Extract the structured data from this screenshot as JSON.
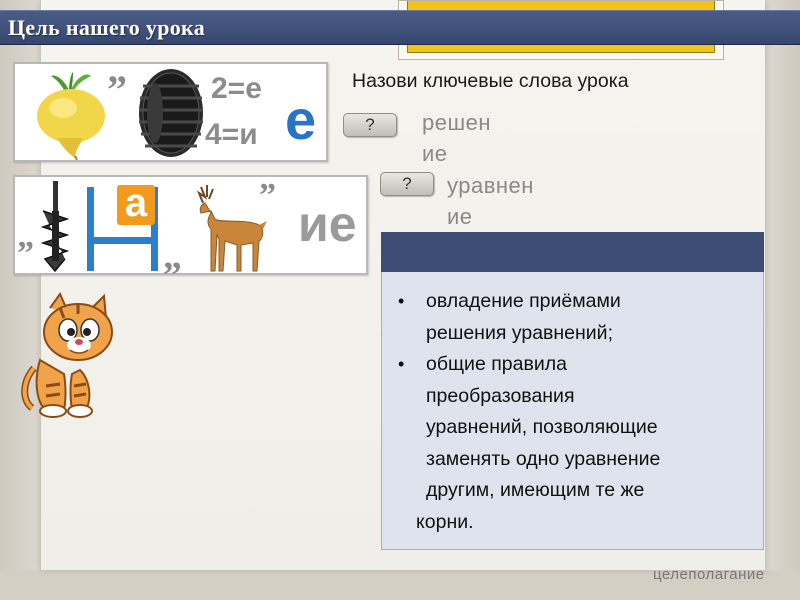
{
  "title": "Цель нашего урока",
  "task": "Назови ключевые слова урока",
  "answer_buttons": {
    "first": "?",
    "second": "?"
  },
  "answers": {
    "first_line1": "решен",
    "first_line2": "ие",
    "second_line1": "уравнен",
    "second_line2": "ие"
  },
  "rebus_1": {
    "quote_after_turnip": "”",
    "eq_top": "2=е",
    "eq_bottom": "4=и",
    "letter": "е"
  },
  "rebus_2": {
    "quote_left": "”",
    "quote_mid": "„",
    "quote_top": "”",
    "letter_a": "а",
    "suffix": "ие"
  },
  "goals": {
    "header": "",
    "items": [
      {
        "lines": [
          "овладение приёмами",
          "решения уравнений;"
        ]
      },
      {
        "lines": [
          "общие правила",
          "преобразования",
          "уравнений, позволяющие",
          "заменять одно уравнение",
          "другим, имеющим те же"
        ],
        "tail": "корни."
      }
    ],
    "bullet": "•"
  },
  "footer_label": "целеполагание",
  "colors": {
    "title_bar": "#3f507a",
    "goals_header": "#3d4d75",
    "goals_body": "#dfe3ee",
    "accent_blue": "#2a73c9",
    "accent_orange": "#f29a1d",
    "top_card": "#f2c418"
  }
}
